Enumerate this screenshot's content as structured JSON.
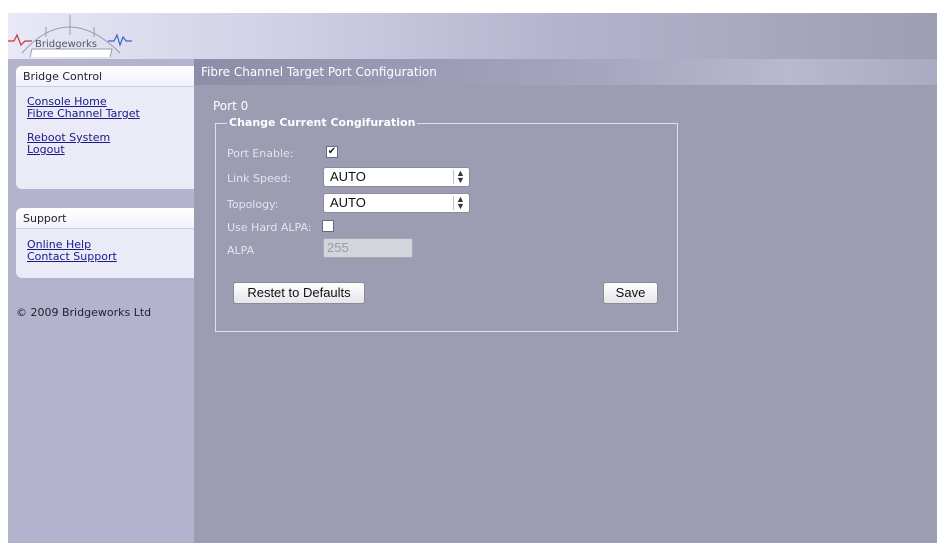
{
  "header": {
    "logo_text": "Bridgeworks"
  },
  "sidebar": {
    "bridge_control": {
      "title": "Bridge Control",
      "links": [
        "Console Home",
        "Fibre Channel Target",
        "Reboot System",
        "Logout"
      ]
    },
    "support": {
      "title": "Support",
      "links": [
        "Online Help",
        "Contact Support"
      ]
    },
    "copyright": "© 2009 Bridgeworks Ltd"
  },
  "main": {
    "page_title": "Fibre Channel Target Port Configuration",
    "port_title": "Port 0",
    "fieldset_legend": "Change Current Congifuration",
    "form": {
      "port_enable_label": "Port Enable:",
      "port_enable_checked": true,
      "link_speed_label": "Link Speed:",
      "link_speed_value": "AUTO",
      "topology_label": "Topology:",
      "topology_value": "AUTO",
      "hard_alpa_label": "Use Hard ALPA:",
      "hard_alpa_checked": false,
      "alpa_label": "ALPA",
      "alpa_value": "255"
    },
    "buttons": {
      "reset_label": "Restet to Defaults",
      "save_label": "Save"
    }
  },
  "colors": {
    "main_bg": "#9c9cb3",
    "sidebar_bg": "#b3b3cd",
    "panel_bg": "#ebebf8",
    "link": "#1a1a88"
  }
}
